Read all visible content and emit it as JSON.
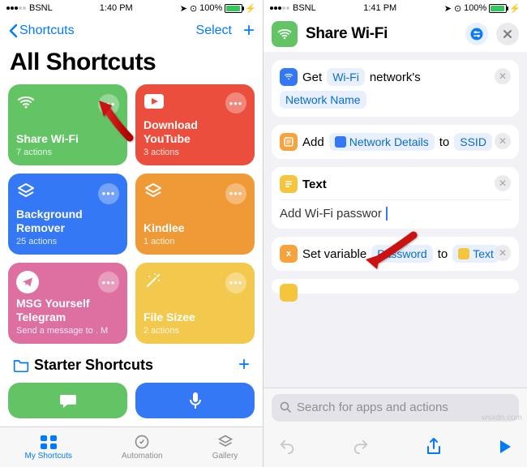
{
  "status": {
    "carrier": "BSNL",
    "time_left": "1:40 PM",
    "time_right": "1:41 PM",
    "battery": "100%",
    "loc_icon": "location-icon",
    "alarm_icon": "alarm-icon",
    "charging_icon": "bolt-icon"
  },
  "nav": {
    "back_label": "Shortcuts",
    "select_label": "Select"
  },
  "title": "All Shortcuts",
  "tiles": [
    {
      "title": "Share Wi-Fi",
      "sub": "7 actions"
    },
    {
      "title": "Download YouTube",
      "sub": "3 actions"
    },
    {
      "title": "Background Remover",
      "sub": "25 actions"
    },
    {
      "title": "Kindlee",
      "sub": "1 action"
    },
    {
      "title": "MSG Yourself Telegram",
      "sub": "Send a message to . M"
    },
    {
      "title": "File Sizee",
      "sub": "2 actions"
    }
  ],
  "starter_label": "Starter Shortcuts",
  "tabs": {
    "my": "My Shortcuts",
    "automation": "Automation",
    "gallery": "Gallery"
  },
  "editor": {
    "title": "Share Wi-Fi",
    "actions": {
      "get_prefix": "Get",
      "wifi_token": "Wi-Fi",
      "get_suffix": "network's",
      "network_name": "Network Name",
      "add_prefix": "Add",
      "network_details": "Network Details",
      "to": "to",
      "ssid": "SSID",
      "text_label": "Text",
      "text_value": "Add Wi-Fi passwor",
      "setvar_prefix": "Set variable",
      "password": "Password",
      "text_token": "Text"
    },
    "search_placeholder": "Search for apps and actions"
  },
  "watermark": "wsxdn.com"
}
